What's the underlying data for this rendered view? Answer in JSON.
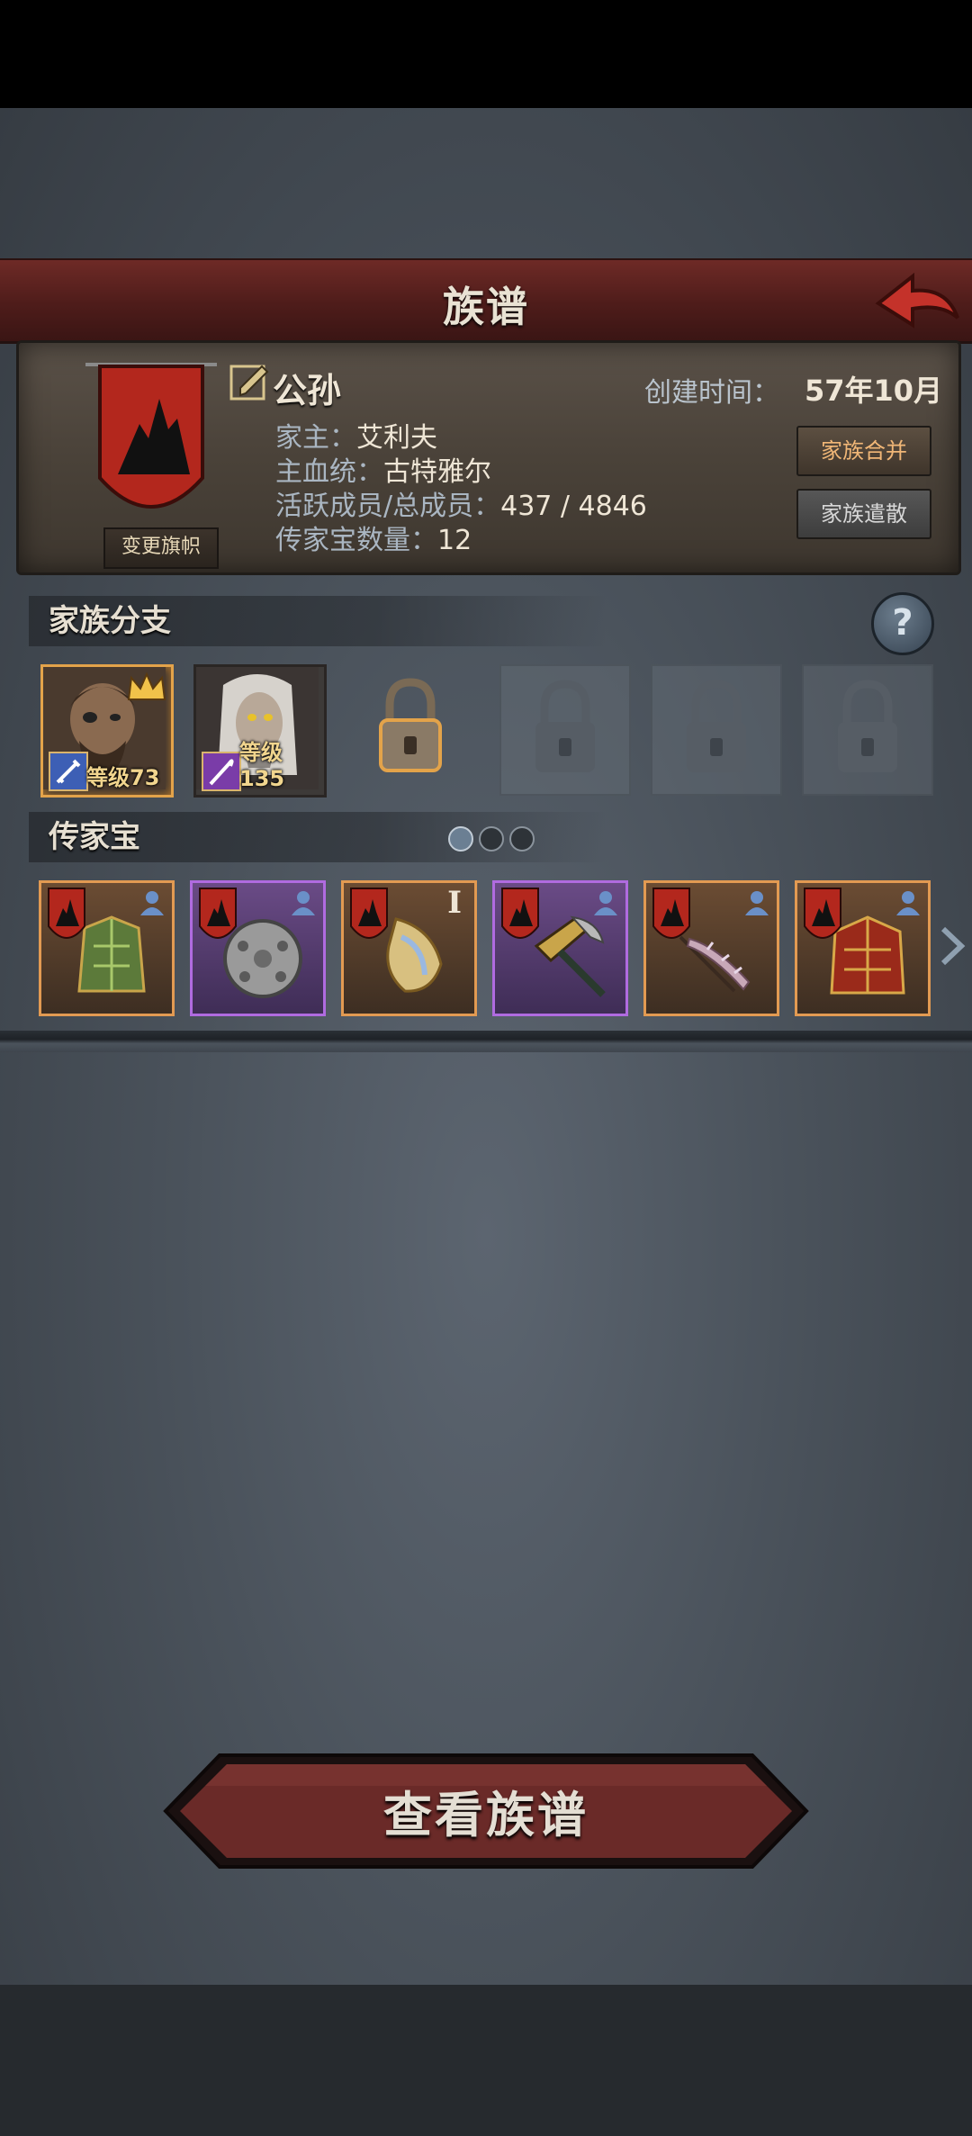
{
  "header": {
    "title": "族谱"
  },
  "clan": {
    "name": "公孙",
    "created_label": "创建时间：",
    "created_value": "57年10月",
    "change_flag": "变更旗帜",
    "head_label": "家主：",
    "head_value": "艾利夫",
    "bloodline_label": "主血统：",
    "bloodline_value": "古特雅尔",
    "members_label": "活跃成员/总成员：",
    "members_value": "437 / 4846",
    "heirloom_label": "传家宝数量：",
    "heirloom_value": "12",
    "merge_btn": "家族合并",
    "disband_btn": "家族遣散"
  },
  "branches": {
    "title": "家族分支",
    "members": [
      {
        "level": "等级73"
      },
      {
        "level": "等级135"
      }
    ]
  },
  "heirlooms": {
    "title": "传家宝",
    "page_count": 3,
    "active_page": 1,
    "items": [
      {
        "name": "green-armor",
        "rarity": "orange"
      },
      {
        "name": "round-shield",
        "rarity": "purple"
      },
      {
        "name": "ornate-relic",
        "rarity": "orange",
        "tier": "I"
      },
      {
        "name": "pickaxe",
        "rarity": "purple"
      },
      {
        "name": "spiked-staff",
        "rarity": "orange"
      },
      {
        "name": "red-armor",
        "rarity": "orange"
      }
    ]
  },
  "footer": {
    "view_btn": "查看族谱"
  },
  "colors": {
    "accent_orange": "#e29a52",
    "accent_purple": "#b06be0",
    "title_red": "#6e2a26"
  }
}
